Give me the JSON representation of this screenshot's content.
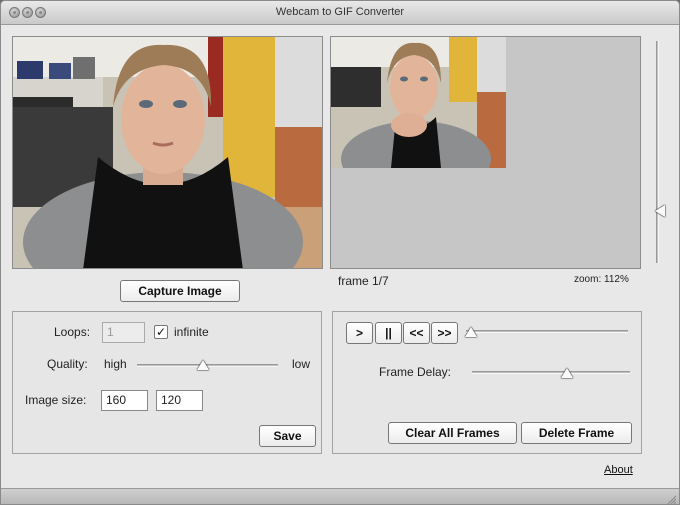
{
  "window": {
    "title": "Webcam to GIF Converter"
  },
  "capture": {
    "button_label": "Capture Image"
  },
  "preview": {
    "frame_label": "frame 1/7",
    "zoom_label": "zoom: 112%",
    "zoom_percent": 112
  },
  "settings": {
    "loops_label": "Loops:",
    "loops_value": "1",
    "infinite_label": "infinite",
    "infinite_checked_mark": "✓",
    "quality_label": "Quality:",
    "quality_high": "high",
    "quality_low": "low",
    "quality_fraction": 0.47,
    "image_size_label": "Image size:",
    "width_value": "160",
    "height_value": "120",
    "save_label": "Save"
  },
  "playback": {
    "play_label": ">",
    "pause_label": "||",
    "prev_label": "<<",
    "next_label": ">>",
    "position_fraction": 0.0,
    "frame_delay_label": "Frame Delay:",
    "frame_delay_fraction": 0.6,
    "clear_all_label": "Clear All Frames",
    "delete_frame_label": "Delete Frame"
  },
  "footer": {
    "about_label": "About"
  }
}
